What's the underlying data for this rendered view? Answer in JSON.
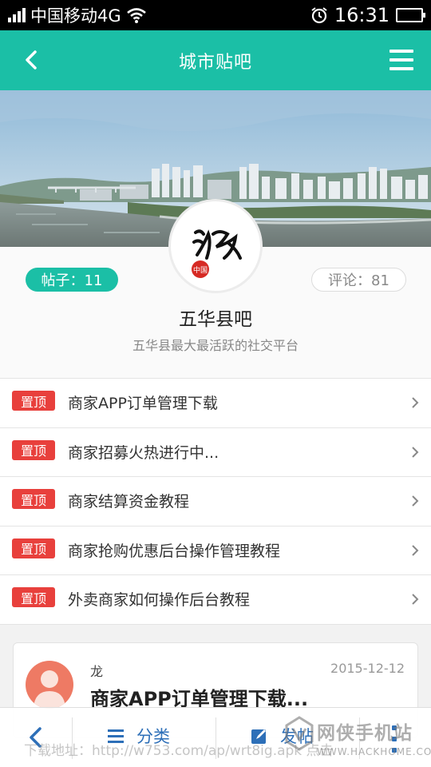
{
  "status_bar": {
    "carrier": "中国移动4G",
    "time": "16:31",
    "icons": [
      "signal-icon",
      "wifi-icon",
      "alarm-icon",
      "battery-icon"
    ]
  },
  "nav": {
    "title": "城市贴吧",
    "back_icon": "chevron-left-icon",
    "menu_icon": "hamburger-menu-icon"
  },
  "banner": {
    "logo_text": "泸州",
    "logo_seal": "中国"
  },
  "forum": {
    "posts_label": "帖子：11",
    "comments_label": "评论：81",
    "name": "五华县吧",
    "description": "五华县最大最活跃的社交平台"
  },
  "pinned": {
    "tag": "置顶",
    "items": [
      {
        "title": "商家APP订单管理下载"
      },
      {
        "title": "商家招募火热进行中..."
      },
      {
        "title": "商家结算资金教程"
      },
      {
        "title": "商家抢购优惠后台操作管理教程"
      },
      {
        "title": "外卖商家如何操作后台教程"
      }
    ]
  },
  "post_card": {
    "author": "龙",
    "date": "2015-12-12",
    "title": "商家APP订单管理下载..."
  },
  "bottom_bar": {
    "category_label": "分类",
    "post_label": "发帖"
  },
  "watermark": {
    "url_text": "下载地址：http://w753.com/ap/wrt8ig.apk 点击",
    "brand_name": "网侠手机站",
    "brand_site": "WWW.HACKHOME.COM"
  },
  "colors": {
    "accent": "#1bbfa6",
    "pin_tag": "#e8403c",
    "bottom_icons": "#2d6fb8"
  }
}
